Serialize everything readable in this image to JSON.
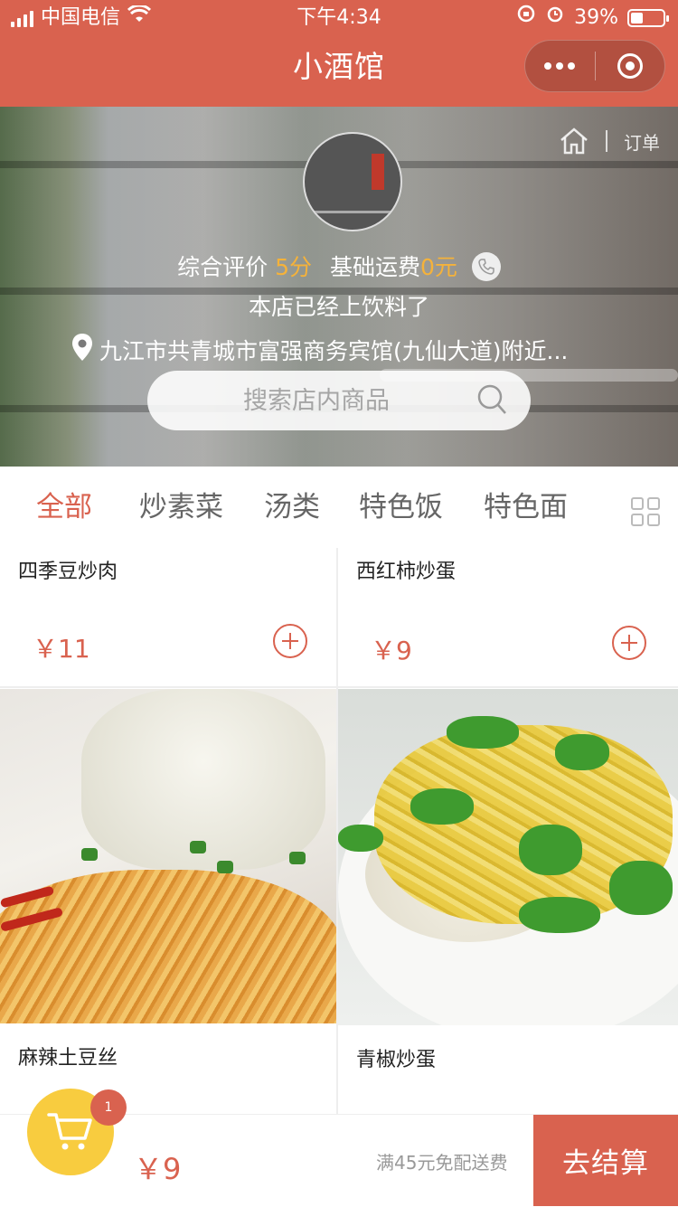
{
  "status_bar": {
    "carrier": "中国电信",
    "time": "下午4:34",
    "battery_percent": "39%",
    "battery_level": 0.39
  },
  "nav": {
    "title": "小酒馆"
  },
  "shop": {
    "links": {
      "orders": "订单"
    },
    "rating_label": "综合评价",
    "rating_value": "5分",
    "fee_label": "基础运费",
    "fee_value": "0元",
    "notice": "本店已经上饮料了",
    "address": "九江市共青城市富强商务宾馆(九仙大道)附近...",
    "search_placeholder": "搜索店内商品"
  },
  "categories": [
    "全部",
    "炒素菜",
    "汤类",
    "特色饭",
    "特色面"
  ],
  "products": [
    {
      "name": "四季豆炒肉",
      "price": "￥11"
    },
    {
      "name": "西红柿炒蛋",
      "price": "￥9"
    },
    {
      "name": "麻辣土豆丝"
    },
    {
      "name": "青椒炒蛋"
    }
  ],
  "cart": {
    "badge": "1",
    "total": "￥9",
    "delivery_note": "满45元免配送费",
    "checkout_label": "去结算"
  },
  "colors": {
    "brand": "#d9624f",
    "highlight": "#f5b23a",
    "cart_button": "#f8cc3f"
  }
}
